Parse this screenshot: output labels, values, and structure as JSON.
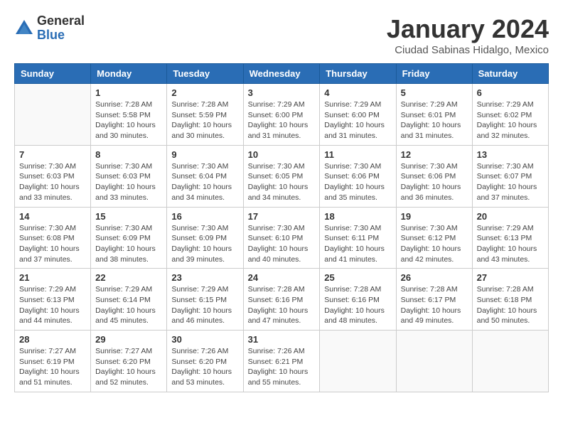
{
  "logo": {
    "general": "General",
    "blue": "Blue"
  },
  "title": "January 2024",
  "subtitle": "Ciudad Sabinas Hidalgo, Mexico",
  "days_header": [
    "Sunday",
    "Monday",
    "Tuesday",
    "Wednesday",
    "Thursday",
    "Friday",
    "Saturday"
  ],
  "weeks": [
    [
      {
        "day": "",
        "info": ""
      },
      {
        "day": "1",
        "info": "Sunrise: 7:28 AM\nSunset: 5:58 PM\nDaylight: 10 hours\nand 30 minutes."
      },
      {
        "day": "2",
        "info": "Sunrise: 7:28 AM\nSunset: 5:59 PM\nDaylight: 10 hours\nand 30 minutes."
      },
      {
        "day": "3",
        "info": "Sunrise: 7:29 AM\nSunset: 6:00 PM\nDaylight: 10 hours\nand 31 minutes."
      },
      {
        "day": "4",
        "info": "Sunrise: 7:29 AM\nSunset: 6:00 PM\nDaylight: 10 hours\nand 31 minutes."
      },
      {
        "day": "5",
        "info": "Sunrise: 7:29 AM\nSunset: 6:01 PM\nDaylight: 10 hours\nand 31 minutes."
      },
      {
        "day": "6",
        "info": "Sunrise: 7:29 AM\nSunset: 6:02 PM\nDaylight: 10 hours\nand 32 minutes."
      }
    ],
    [
      {
        "day": "7",
        "info": "Sunrise: 7:30 AM\nSunset: 6:03 PM\nDaylight: 10 hours\nand 33 minutes."
      },
      {
        "day": "8",
        "info": "Sunrise: 7:30 AM\nSunset: 6:03 PM\nDaylight: 10 hours\nand 33 minutes."
      },
      {
        "day": "9",
        "info": "Sunrise: 7:30 AM\nSunset: 6:04 PM\nDaylight: 10 hours\nand 34 minutes."
      },
      {
        "day": "10",
        "info": "Sunrise: 7:30 AM\nSunset: 6:05 PM\nDaylight: 10 hours\nand 34 minutes."
      },
      {
        "day": "11",
        "info": "Sunrise: 7:30 AM\nSunset: 6:06 PM\nDaylight: 10 hours\nand 35 minutes."
      },
      {
        "day": "12",
        "info": "Sunrise: 7:30 AM\nSunset: 6:06 PM\nDaylight: 10 hours\nand 36 minutes."
      },
      {
        "day": "13",
        "info": "Sunrise: 7:30 AM\nSunset: 6:07 PM\nDaylight: 10 hours\nand 37 minutes."
      }
    ],
    [
      {
        "day": "14",
        "info": "Sunrise: 7:30 AM\nSunset: 6:08 PM\nDaylight: 10 hours\nand 37 minutes."
      },
      {
        "day": "15",
        "info": "Sunrise: 7:30 AM\nSunset: 6:09 PM\nDaylight: 10 hours\nand 38 minutes."
      },
      {
        "day": "16",
        "info": "Sunrise: 7:30 AM\nSunset: 6:09 PM\nDaylight: 10 hours\nand 39 minutes."
      },
      {
        "day": "17",
        "info": "Sunrise: 7:30 AM\nSunset: 6:10 PM\nDaylight: 10 hours\nand 40 minutes."
      },
      {
        "day": "18",
        "info": "Sunrise: 7:30 AM\nSunset: 6:11 PM\nDaylight: 10 hours\nand 41 minutes."
      },
      {
        "day": "19",
        "info": "Sunrise: 7:30 AM\nSunset: 6:12 PM\nDaylight: 10 hours\nand 42 minutes."
      },
      {
        "day": "20",
        "info": "Sunrise: 7:29 AM\nSunset: 6:13 PM\nDaylight: 10 hours\nand 43 minutes."
      }
    ],
    [
      {
        "day": "21",
        "info": "Sunrise: 7:29 AM\nSunset: 6:13 PM\nDaylight: 10 hours\nand 44 minutes."
      },
      {
        "day": "22",
        "info": "Sunrise: 7:29 AM\nSunset: 6:14 PM\nDaylight: 10 hours\nand 45 minutes."
      },
      {
        "day": "23",
        "info": "Sunrise: 7:29 AM\nSunset: 6:15 PM\nDaylight: 10 hours\nand 46 minutes."
      },
      {
        "day": "24",
        "info": "Sunrise: 7:28 AM\nSunset: 6:16 PM\nDaylight: 10 hours\nand 47 minutes."
      },
      {
        "day": "25",
        "info": "Sunrise: 7:28 AM\nSunset: 6:16 PM\nDaylight: 10 hours\nand 48 minutes."
      },
      {
        "day": "26",
        "info": "Sunrise: 7:28 AM\nSunset: 6:17 PM\nDaylight: 10 hours\nand 49 minutes."
      },
      {
        "day": "27",
        "info": "Sunrise: 7:28 AM\nSunset: 6:18 PM\nDaylight: 10 hours\nand 50 minutes."
      }
    ],
    [
      {
        "day": "28",
        "info": "Sunrise: 7:27 AM\nSunset: 6:19 PM\nDaylight: 10 hours\nand 51 minutes."
      },
      {
        "day": "29",
        "info": "Sunrise: 7:27 AM\nSunset: 6:20 PM\nDaylight: 10 hours\nand 52 minutes."
      },
      {
        "day": "30",
        "info": "Sunrise: 7:26 AM\nSunset: 6:20 PM\nDaylight: 10 hours\nand 53 minutes."
      },
      {
        "day": "31",
        "info": "Sunrise: 7:26 AM\nSunset: 6:21 PM\nDaylight: 10 hours\nand 55 minutes."
      },
      {
        "day": "",
        "info": ""
      },
      {
        "day": "",
        "info": ""
      },
      {
        "day": "",
        "info": ""
      }
    ]
  ]
}
